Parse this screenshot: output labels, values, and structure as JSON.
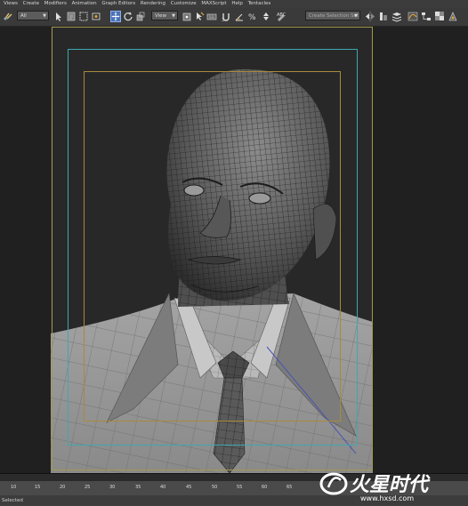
{
  "menu": {
    "items": [
      "Views",
      "Create",
      "Modifiers",
      "Animation",
      "Graph Editors",
      "Rendering",
      "Customize",
      "MAXScript",
      "Help",
      "Tentacles"
    ]
  },
  "toolbar": {
    "selection_filter": "All",
    "reference_coord": "View",
    "named_selection_placeholder": "Create Selection Set"
  },
  "viewport": {
    "safe_frame_outer_color": "#a19a4e",
    "action_safe_color": "#3ea8b0",
    "title_safe_color": "#a88a3a"
  },
  "timeline": {
    "ticks": [
      "10",
      "15",
      "20",
      "25",
      "30",
      "35",
      "40",
      "45",
      "50",
      "55",
      "60",
      "65"
    ]
  },
  "status": {
    "text": "Selected"
  },
  "watermark": {
    "brand": "火星时代",
    "url": "www.hxsd.com"
  }
}
